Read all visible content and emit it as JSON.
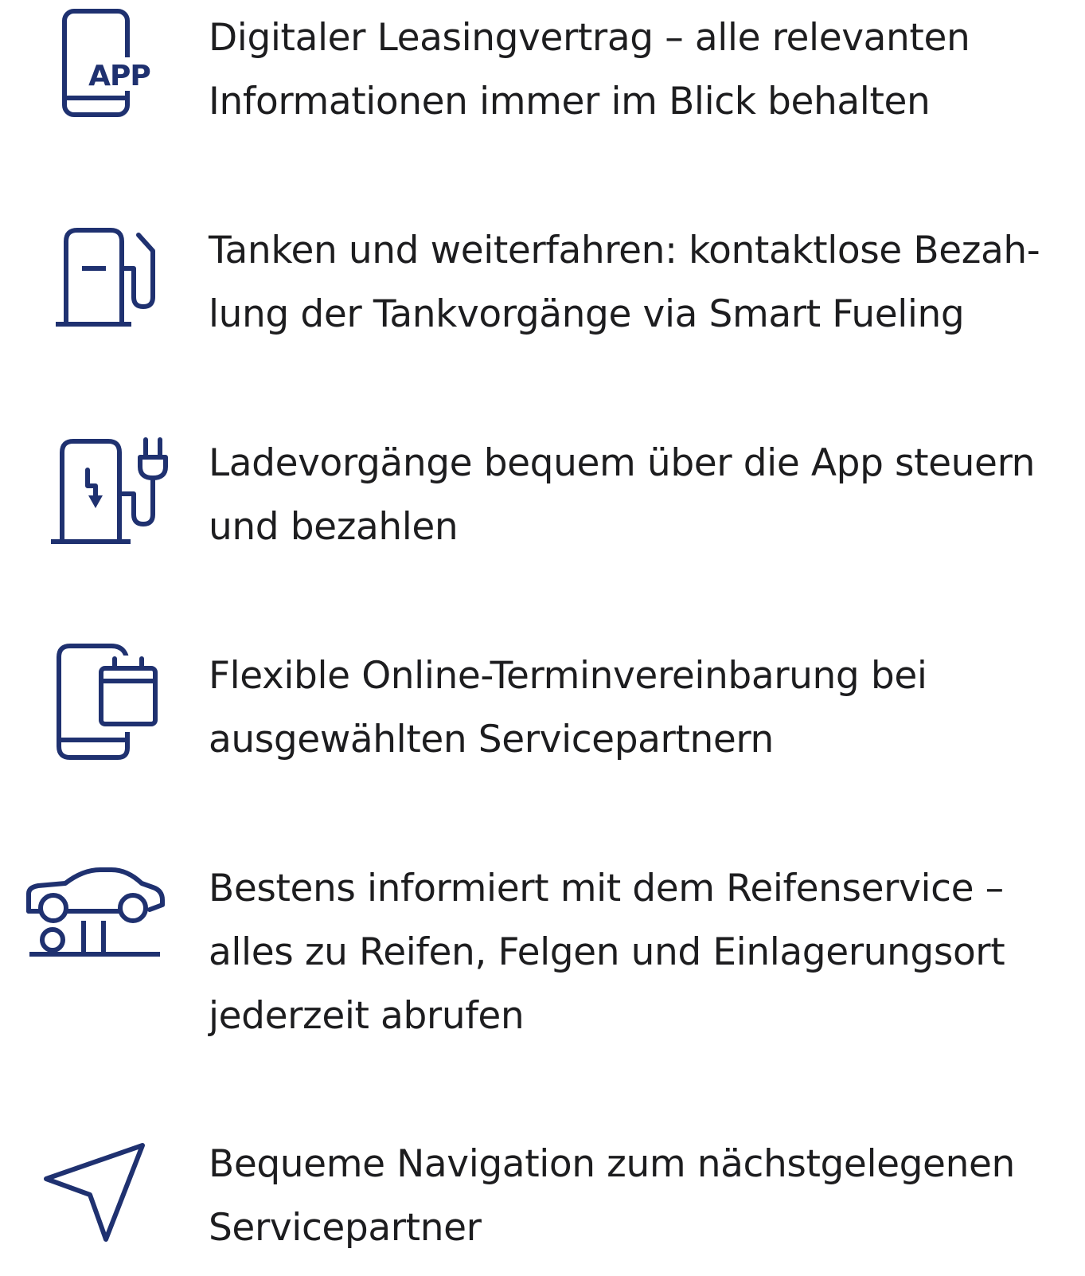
{
  "colors": {
    "icon": "#1f3170",
    "text": "#1d1d1f",
    "background": "#ffffff"
  },
  "features": [
    {
      "icon": "smartphone-app-icon",
      "icon_label": "APP",
      "text": "Digitaler Leasingvertrag – alle relevanten\nInformationen immer im Blick behalten"
    },
    {
      "icon": "fuel-pump-icon",
      "text": "Tanken und weiterfahren: kontaktlose Bezah-\nlung der Tankvorgänge via Smart Fueling"
    },
    {
      "icon": "ev-charging-station-icon",
      "text": "Ladevorgänge bequem über die App steuern\nund bezahlen"
    },
    {
      "icon": "smartphone-calendar-icon",
      "text": "Flexible Online-Terminvereinbarung bei\nausgewählten Servicepartnern"
    },
    {
      "icon": "car-on-lift-icon",
      "text": "Bestens informiert mit dem Reifenservice –\nalles zu Reifen, Felgen und Einlagerungsort\njederzeit abrufen"
    },
    {
      "icon": "navigation-arrow-icon",
      "text": "Bequeme Navigation zum nächstgelegenen\nServicepartner"
    }
  ]
}
